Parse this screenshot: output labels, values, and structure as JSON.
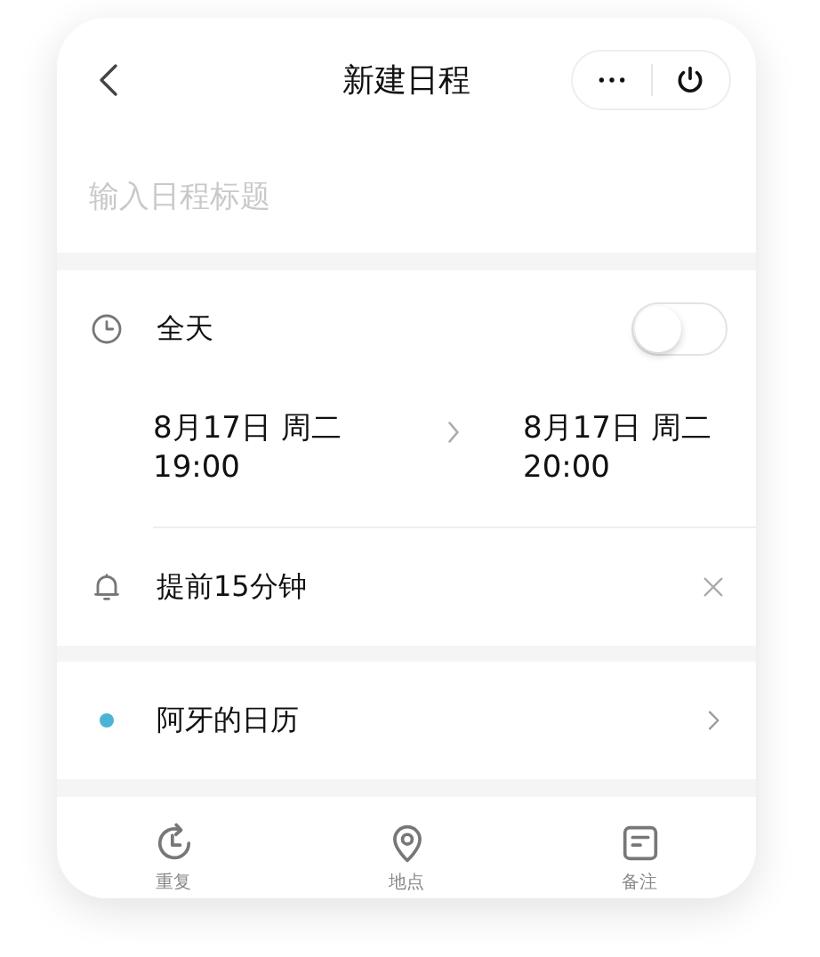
{
  "header": {
    "title": "新建日程"
  },
  "title_field": {
    "placeholder": "输入日程标题"
  },
  "all_day": {
    "label": "全天",
    "on": false
  },
  "start": {
    "date": "8月17日 周二",
    "time": "19:00"
  },
  "end": {
    "date": "8月17日 周二",
    "time": "20:00"
  },
  "reminder": {
    "text": "提前15分钟"
  },
  "calendar": {
    "name": "阿牙的日历",
    "color": "#4bb4d4"
  },
  "toolbar": [
    {
      "kind": "repeat",
      "label": "重复"
    },
    {
      "kind": "location",
      "label": "地点"
    },
    {
      "kind": "note",
      "label": "备注"
    }
  ]
}
